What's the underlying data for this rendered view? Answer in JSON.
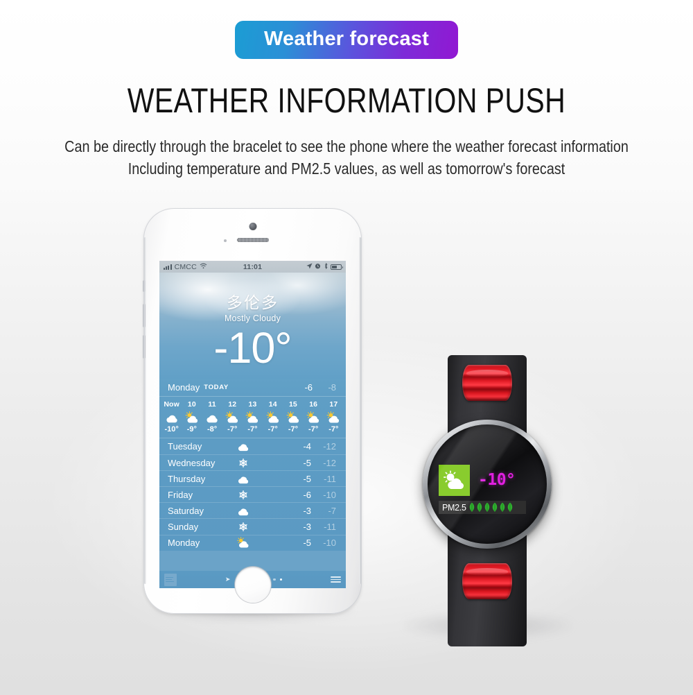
{
  "header": {
    "badge_label": "Weather forecast",
    "headline": "WEATHER INFORMATION PUSH",
    "subline_1": "Can be directly through the bracelet to see the phone where the weather forecast information",
    "subline_2": "Including temperature and PM2.5 values, as well as tomorrow's forecast",
    "badge_gradient_start": "#1b9dd4",
    "badge_gradient_end": "#9118d2"
  },
  "phone": {
    "status_bar": {
      "carrier": "CMCC",
      "time": "11:01",
      "wifi_icon": "wifi-icon",
      "signal_icon": "signal-bars-icon",
      "location_icon": "location-arrow-icon",
      "alarm_icon": "alarm-clock-icon",
      "bluetooth_icon": "bluetooth-icon",
      "battery_icon": "battery-icon"
    },
    "hero": {
      "city": "多伦多",
      "condition": "Mostly Cloudy",
      "temperature": "-10°"
    },
    "today": {
      "day": "Monday",
      "label": "TODAY",
      "high": "-6",
      "low": "-8"
    },
    "hourly": [
      {
        "time": "Now",
        "icon": "cloud-icon",
        "temp": "-10°"
      },
      {
        "time": "10",
        "icon": "sun-cloud-icon",
        "temp": "-9°"
      },
      {
        "time": "11",
        "icon": "cloud-icon",
        "temp": "-8°"
      },
      {
        "time": "12",
        "icon": "sun-cloud-icon",
        "temp": "-7°"
      },
      {
        "time": "13",
        "icon": "sun-cloud-icon",
        "temp": "-7°"
      },
      {
        "time": "14",
        "icon": "sun-cloud-icon",
        "temp": "-7°"
      },
      {
        "time": "15",
        "icon": "sun-cloud-icon",
        "temp": "-7°"
      },
      {
        "time": "16",
        "icon": "sun-cloud-icon",
        "temp": "-7°"
      },
      {
        "time": "17",
        "icon": "sun-cloud-icon",
        "temp": "-7°"
      }
    ],
    "daily": [
      {
        "day": "Tuesday",
        "icon": "cloud-icon",
        "high": "-4",
        "low": "-12"
      },
      {
        "day": "Wednesday",
        "icon": "snowflake-icon",
        "high": "-5",
        "low": "-12"
      },
      {
        "day": "Thursday",
        "icon": "cloud-icon",
        "high": "-5",
        "low": "-11"
      },
      {
        "day": "Friday",
        "icon": "snowflake-icon",
        "high": "-6",
        "low": "-10"
      },
      {
        "day": "Saturday",
        "icon": "cloud-icon",
        "high": "-3",
        "low": "-7"
      },
      {
        "day": "Sunday",
        "icon": "snowflake-icon",
        "high": "-3",
        "low": "-11"
      },
      {
        "day": "Monday",
        "icon": "sun-cloud-icon",
        "high": "-5",
        "low": "-10"
      }
    ],
    "tab_bar": {
      "logo_icon": "weather-channel-logo-icon",
      "location_icon": "location-arrow-icon",
      "page_dots": 8,
      "active_dot_index": 7,
      "list_icon": "list-icon"
    }
  },
  "watch": {
    "weather_icon": "sun-cloud-icon",
    "weather_icon_color": "#7ec71a",
    "temperature": "-10°",
    "temperature_color": "#e01fe0",
    "pm_label": "PM2.5",
    "pm_leaf_count": 6,
    "pm_leaf_color": "#2fb02f",
    "strap_color": "#2a2a2d",
    "keeper_color": "#d9161f"
  }
}
